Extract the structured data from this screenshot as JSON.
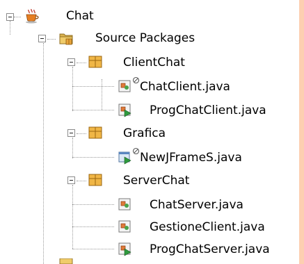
{
  "tree": {
    "root": {
      "label": "Chat",
      "icon": "coffee-cup-project-icon"
    },
    "source_packages": {
      "label": "Source Packages",
      "icon": "source-packages-folder-icon"
    },
    "packages": [
      {
        "label": "ClientChat",
        "icon": "package-icon",
        "files": [
          {
            "label": "ChatClient.java",
            "icon": "java-class-icon",
            "badge": "link-badge-icon"
          },
          {
            "label": "ProgChatClient.java",
            "icon": "java-main-class-icon"
          }
        ]
      },
      {
        "label": "Grafica",
        "icon": "package-icon",
        "files": [
          {
            "label": "NewJFrameS.java",
            "icon": "jframe-form-icon",
            "badge": "link-badge-icon"
          }
        ]
      },
      {
        "label": "ServerChat",
        "icon": "package-icon",
        "files": [
          {
            "label": "ChatServer.java",
            "icon": "java-class-icon"
          },
          {
            "label": "GestioneClient.java",
            "icon": "java-class-icon"
          },
          {
            "label": "ProgChatServer.java",
            "icon": "java-main-class-icon"
          }
        ]
      }
    ]
  },
  "colors": {
    "background": "#fdcfb1",
    "panel": "#ffffff",
    "package_icon": "#e8a93a",
    "folder_icon": "#c8a04a"
  }
}
